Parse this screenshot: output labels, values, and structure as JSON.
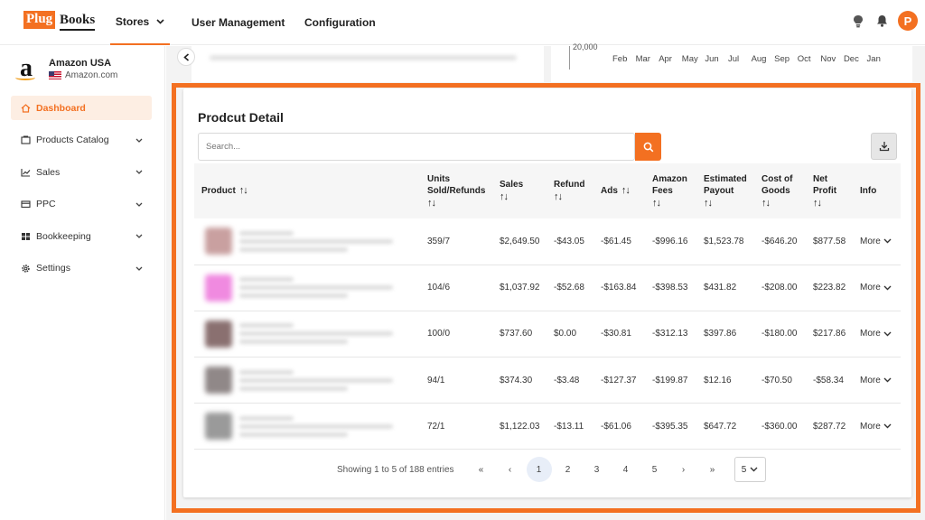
{
  "brand": {
    "logo_plug": "Plug",
    "logo_books": "Books",
    "color": "#f37021"
  },
  "nav": {
    "stores": "Stores",
    "user_management": "User Management",
    "configuration": "Configuration"
  },
  "topbar": {
    "avatar_letter": "P",
    "icons": [
      "lightbulb-icon",
      "bell-icon"
    ]
  },
  "store": {
    "name": "Amazon USA",
    "domain": "Amazon.com",
    "logo_letter": "a"
  },
  "sidebar": {
    "items": [
      {
        "label": "Dashboard",
        "icon": "home-icon",
        "active": true
      },
      {
        "label": "Products Catalog",
        "icon": "catalog-icon"
      },
      {
        "label": "Sales",
        "icon": "chart-icon"
      },
      {
        "label": "PPC",
        "icon": "card-icon"
      },
      {
        "label": "Bookkeeping",
        "icon": "grid-icon"
      },
      {
        "label": "Settings",
        "icon": "gear-icon"
      }
    ]
  },
  "chart_strip": {
    "ytick": "20,000",
    "months": [
      "Feb",
      "Mar",
      "Apr",
      "May",
      "Jun",
      "Jul",
      "Aug",
      "Sep",
      "Oct",
      "Nov",
      "Dec",
      "Jan"
    ]
  },
  "product_detail": {
    "title": "Prodcut Detail",
    "search_placeholder": "Search...",
    "columns": {
      "product": "Product",
      "units_l1": "Units",
      "units_l2": "Sold/Refunds",
      "sales": "Sales",
      "refund": "Refund",
      "ads": "Ads",
      "fees_l1": "Amazon",
      "fees_l2": "Fees",
      "payout_l1": "Estimated",
      "payout_l2": "Payout",
      "cogs_l1": "Cost of",
      "cogs_l2": "Goods",
      "profit_l1": "Net",
      "profit_l2": "Profit",
      "info": "Info"
    },
    "rows": [
      {
        "units": "359/7",
        "sales": "$2,649.50",
        "refund": "-$43.05",
        "ads": "-$61.45",
        "fees": "-$996.16",
        "payout": "$1,523.78",
        "cogs": "-$646.20",
        "profit": "$877.58",
        "more": "More",
        "thumb": "#c9a0a0"
      },
      {
        "units": "104/6",
        "sales": "$1,037.92",
        "refund": "-$52.68",
        "ads": "-$163.84",
        "fees": "-$398.53",
        "payout": "$431.82",
        "cogs": "-$208.00",
        "profit": "$223.82",
        "more": "More",
        "thumb": "#f08ae0"
      },
      {
        "units": "100/0",
        "sales": "$737.60",
        "refund": "$0.00",
        "ads": "-$30.81",
        "fees": "-$312.13",
        "payout": "$397.86",
        "cogs": "-$180.00",
        "profit": "$217.86",
        "more": "More",
        "thumb": "#8a7070"
      },
      {
        "units": "94/1",
        "sales": "$374.30",
        "refund": "-$3.48",
        "ads": "-$127.37",
        "fees": "-$199.87",
        "payout": "$12.16",
        "cogs": "-$70.50",
        "profit": "-$58.34",
        "more": "More",
        "thumb": "#908888"
      },
      {
        "units": "72/1",
        "sales": "$1,122.03",
        "refund": "-$13.11",
        "ads": "-$61.06",
        "fees": "-$395.35",
        "payout": "$647.72",
        "cogs": "-$360.00",
        "profit": "$287.72",
        "more": "More",
        "thumb": "#9a9a9a"
      }
    ],
    "pagination": {
      "info": "Showing 1 to 5 of 188 entries",
      "first": "«",
      "prev": "‹",
      "pages": [
        "1",
        "2",
        "3",
        "4",
        "5"
      ],
      "current": "1",
      "next": "›",
      "last": "»",
      "page_size": "5"
    }
  }
}
